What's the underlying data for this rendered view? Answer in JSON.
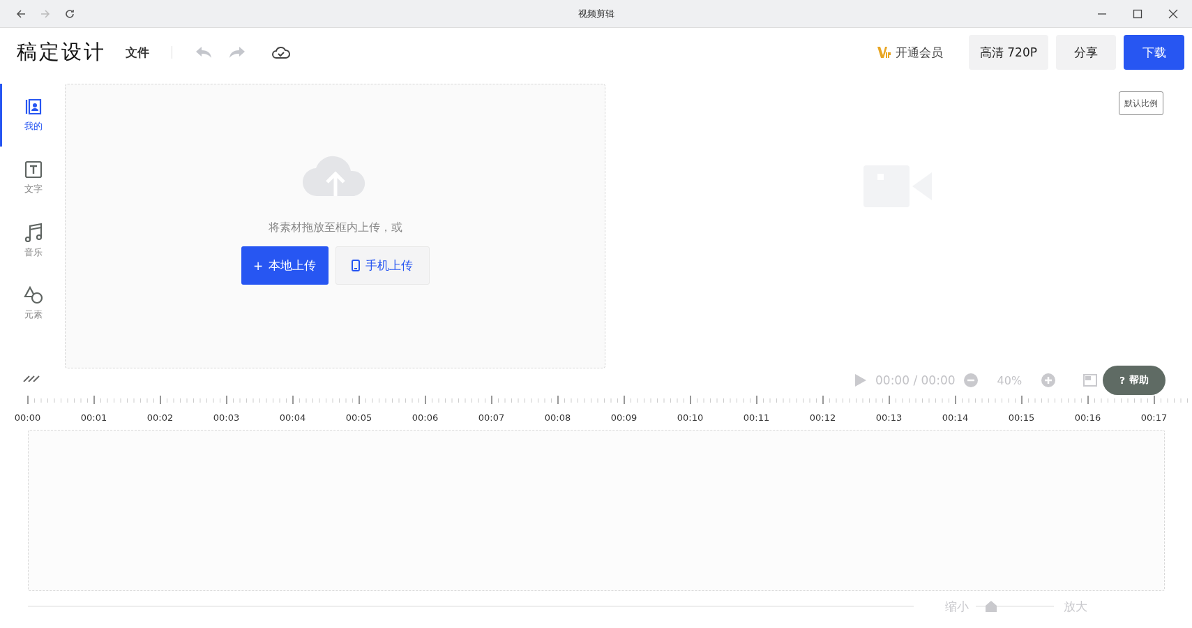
{
  "window": {
    "title": "视频剪辑"
  },
  "header": {
    "logo": "稿定设计",
    "menu": "文件",
    "vip": "开通会员",
    "buttons": [
      {
        "label": "高清 720P",
        "kind": "plain"
      },
      {
        "label": "分享",
        "kind": "plain"
      },
      {
        "label": "下载",
        "kind": "primary"
      }
    ]
  },
  "sidebar": {
    "items": [
      {
        "label": "我的",
        "selected": true
      },
      {
        "label": "文字",
        "selected": false
      },
      {
        "label": "音乐",
        "selected": false
      },
      {
        "label": "元素",
        "selected": false
      }
    ]
  },
  "upload": {
    "hint": "将素材拖放至框内上传，或",
    "buttons": [
      {
        "prefix": "+",
        "label": "本地上传",
        "kind": "primary"
      },
      {
        "label": "手机上传",
        "kind": "phone"
      }
    ]
  },
  "preview": {
    "ratio_button": "默认比例",
    "time": "00:00 / 00:00",
    "zoom": "40%",
    "help_prefix": "?",
    "help": "帮助"
  },
  "timeline": {
    "ticks": [
      "00:00",
      "00:01",
      "00:02",
      "00:03",
      "00:04",
      "00:05",
      "00:06",
      "00:07",
      "00:08",
      "00:09",
      "00:10",
      "00:11",
      "00:12",
      "00:13",
      "00:14",
      "00:15",
      "00:16",
      "00:17"
    ],
    "zoom_out": "缩小",
    "zoom_in": "放大",
    "scale": {
      "level": 0.2
    }
  }
}
